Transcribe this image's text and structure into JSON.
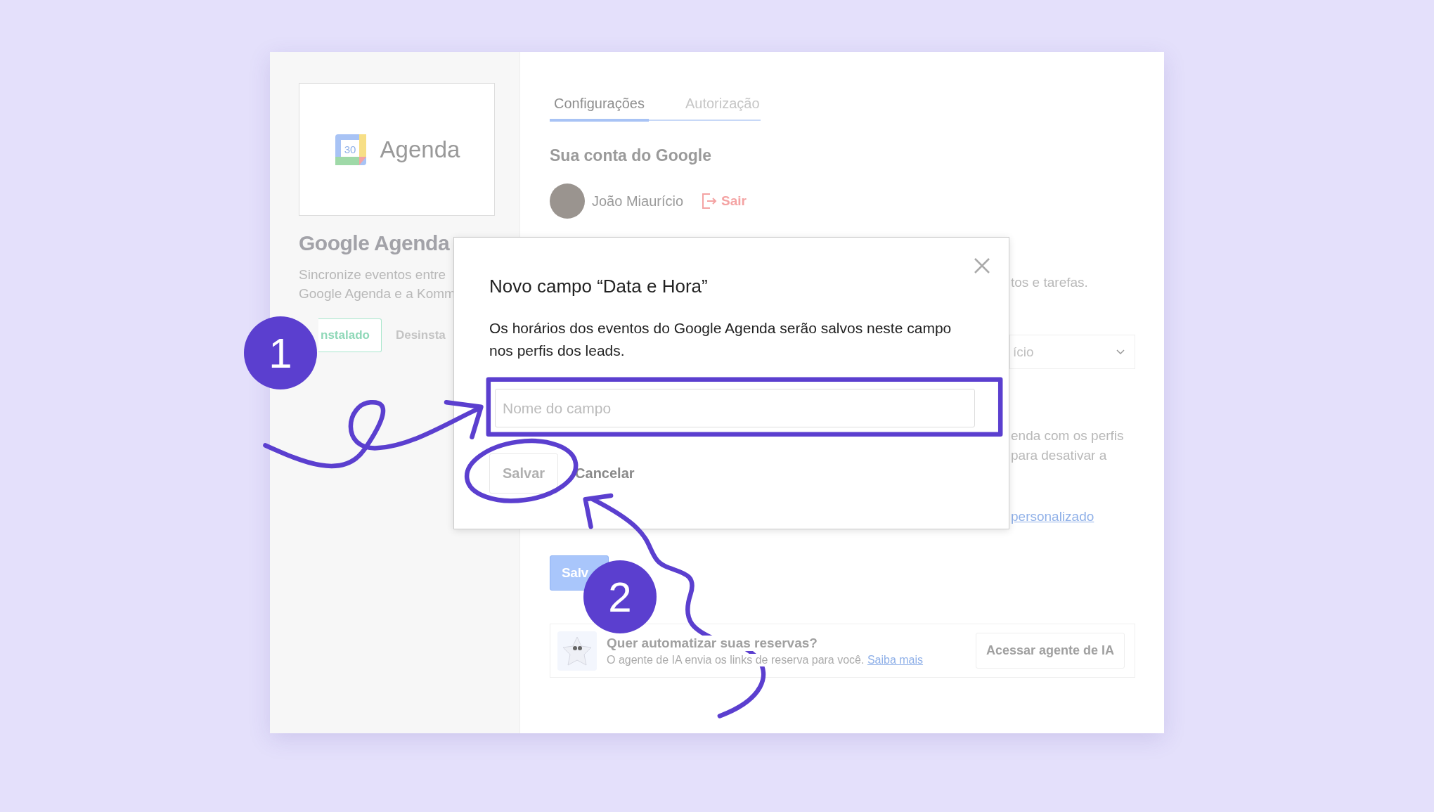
{
  "sidebar": {
    "logo_date": "30",
    "logo_text": "Agenda",
    "title": "Google Agenda",
    "description": [
      "Sincronize eventos entre",
      "Google Agenda e a Komm"
    ],
    "buttons": [
      {
        "label": "nstalado",
        "kind": "installed"
      },
      {
        "label": "Desinsta",
        "kind": "plain"
      }
    ]
  },
  "tabs": [
    {
      "label": "Configurações",
      "selected": true
    },
    {
      "label": "Autorização",
      "selected": false
    }
  ],
  "account": {
    "heading": "Sua conta do Google",
    "name": "João Miaurício",
    "logout": "Sair"
  },
  "partial": {
    "description": "tos e tarefas.",
    "dropdown": "ício",
    "text_lines": [
      "enda com os perfis",
      "para desativar a"
    ],
    "link": "personalizado"
  },
  "save_button": "Salv",
  "banner": {
    "title": "Quer automatizar suas reservas?",
    "text": "O agente de IA envia os links de reserva para você.",
    "link": "Saiba mais",
    "button": "Acessar agente de IA"
  },
  "dialog": {
    "title": "Novo campo “Data e Hora”",
    "body": "Os horários dos eventos do Google Agenda serão salvos neste campo nos perfis dos leads.",
    "field": {
      "placeholder": "Nome do campo"
    },
    "buttons": [
      {
        "label": "Salvar",
        "kind": "secondary"
      },
      {
        "label": "Cancelar",
        "kind": "link"
      }
    ]
  },
  "annotations": [
    {
      "number": "1"
    },
    {
      "number": "2"
    }
  ]
}
